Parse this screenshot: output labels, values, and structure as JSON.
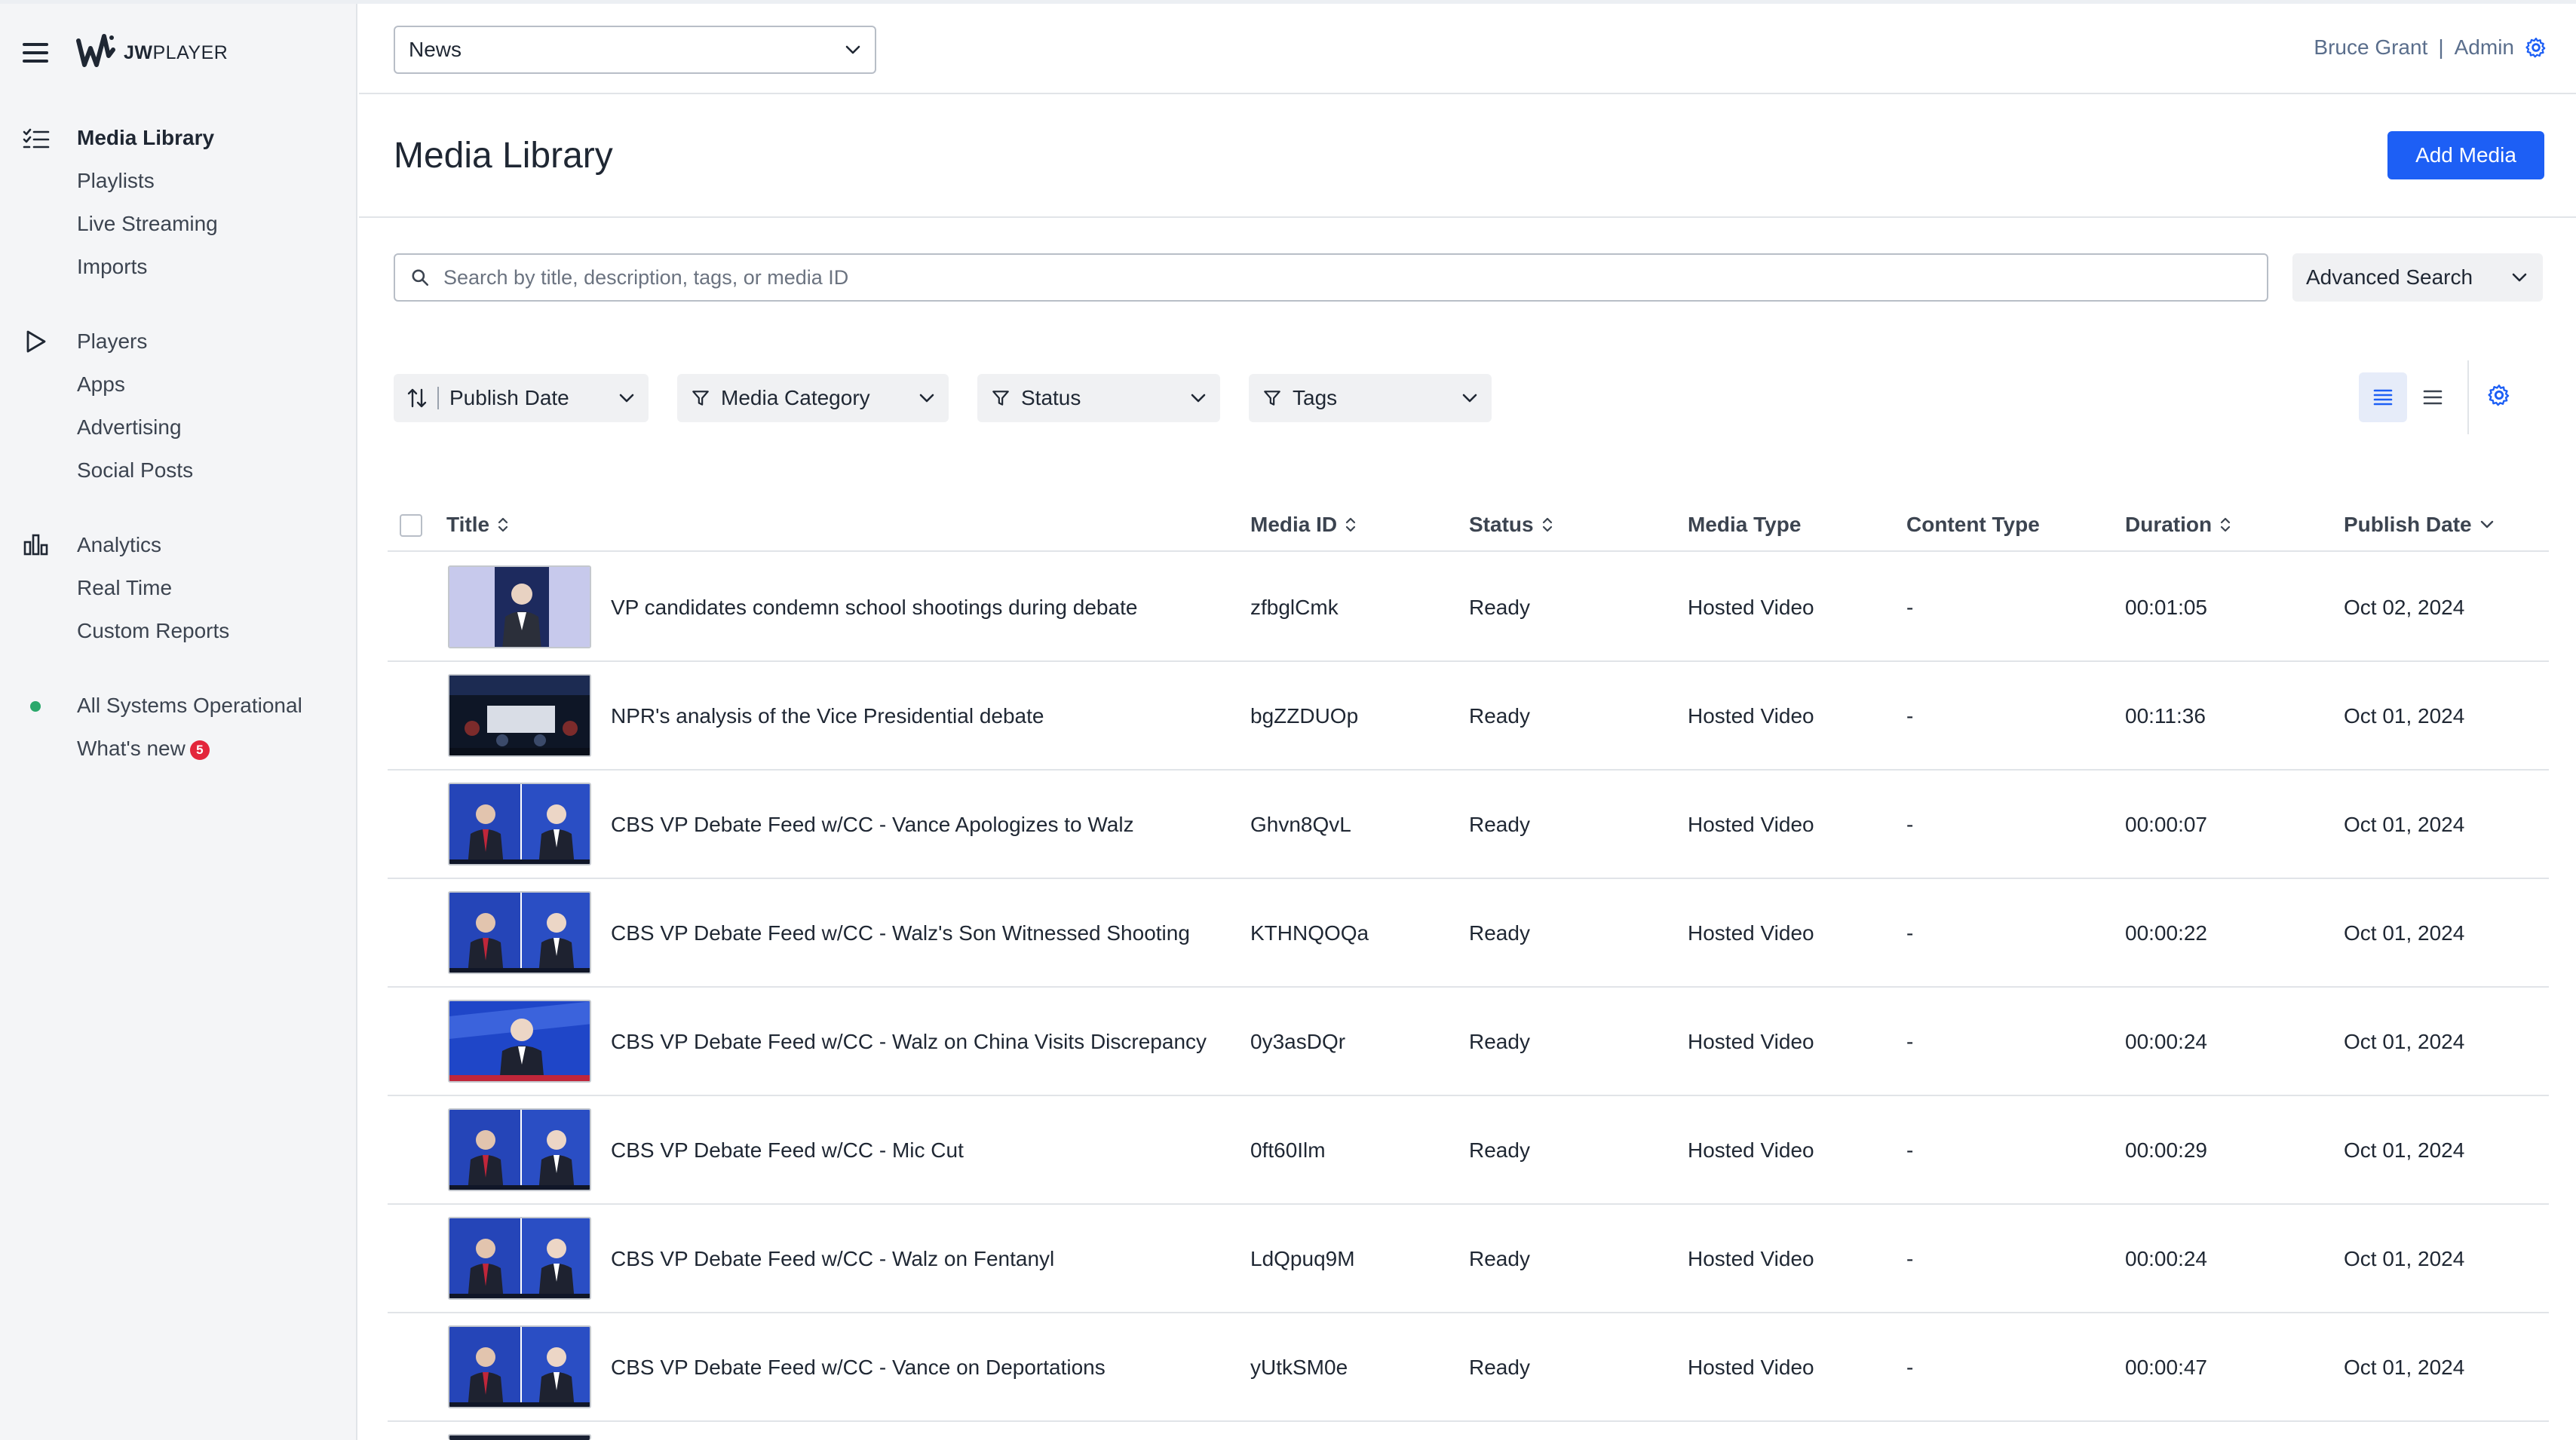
{
  "brand": {
    "name_bold": "JW",
    "name_light": "PLAYER"
  },
  "sidebar": {
    "group1": [
      "Media Library",
      "Playlists",
      "Live Streaming",
      "Imports"
    ],
    "group2": [
      "Players",
      "Apps",
      "Advertising",
      "Social Posts"
    ],
    "group3": [
      "Analytics",
      "Real Time",
      "Custom Reports"
    ],
    "status": "All Systems Operational",
    "whats_new": "What's new",
    "whats_new_count": "5"
  },
  "topbar": {
    "property_select": "News",
    "user_name": "Bruce Grant",
    "separator": "|",
    "role": "Admin"
  },
  "header": {
    "title": "Media Library",
    "add_button": "Add Media"
  },
  "search": {
    "placeholder": "Search by title, description, tags, or media ID",
    "advanced_label": "Advanced Search"
  },
  "filters": {
    "sort": "Publish Date",
    "category": "Media Category",
    "status": "Status",
    "tags": "Tags"
  },
  "table": {
    "columns": {
      "title": "Title",
      "media_id": "Media ID",
      "status": "Status",
      "media_type": "Media Type",
      "content_type": "Content Type",
      "duration": "Duration",
      "publish_date": "Publish Date"
    },
    "rows": [
      {
        "title": "VP candidates condemn school shootings during debate",
        "media_id": "zfbglCmk",
        "status": "Ready",
        "media_type": "Hosted Video",
        "content_type": "-",
        "duration": "00:01:05",
        "publish_date": "Oct 02, 2024"
      },
      {
        "title": "NPR's analysis of the Vice Presidential debate",
        "media_id": "bgZZDUOp",
        "status": "Ready",
        "media_type": "Hosted Video",
        "content_type": "-",
        "duration": "00:11:36",
        "publish_date": "Oct 01, 2024"
      },
      {
        "title": "CBS VP Debate Feed w/CC - Vance Apologizes to Walz",
        "media_id": "Ghvn8QvL",
        "status": "Ready",
        "media_type": "Hosted Video",
        "content_type": "-",
        "duration": "00:00:07",
        "publish_date": "Oct 01, 2024"
      },
      {
        "title": "CBS VP Debate Feed w/CC - Walz's Son Witnessed Shooting",
        "media_id": "KTHNQOQa",
        "status": "Ready",
        "media_type": "Hosted Video",
        "content_type": "-",
        "duration": "00:00:22",
        "publish_date": "Oct 01, 2024"
      },
      {
        "title": "CBS VP Debate Feed w/CC - Walz on China Visits Discrepancy",
        "media_id": "0y3asDQr",
        "status": "Ready",
        "media_type": "Hosted Video",
        "content_type": "-",
        "duration": "00:00:24",
        "publish_date": "Oct 01, 2024"
      },
      {
        "title": "CBS VP Debate Feed w/CC - Mic Cut",
        "media_id": "0ft60Ilm",
        "status": "Ready",
        "media_type": "Hosted Video",
        "content_type": "-",
        "duration": "00:00:29",
        "publish_date": "Oct 01, 2024"
      },
      {
        "title": "CBS VP Debate Feed w/CC - Walz on Fentanyl",
        "media_id": "LdQpuq9M",
        "status": "Ready",
        "media_type": "Hosted Video",
        "content_type": "-",
        "duration": "00:00:24",
        "publish_date": "Oct 01, 2024"
      },
      {
        "title": "CBS VP Debate Feed w/CC - Vance on Deportations",
        "media_id": "yUtkSM0e",
        "status": "Ready",
        "media_type": "Hosted Video",
        "content_type": "-",
        "duration": "00:00:47",
        "publish_date": "Oct 01, 2024"
      }
    ]
  },
  "colors": {
    "accent": "#1d5ff5",
    "sidebar_bg": "#f4f5f7",
    "status_ok": "#2aa86b",
    "badge": "#e3263b"
  },
  "icons": [
    "menu-icon",
    "media-library-icon",
    "players-icon",
    "analytics-icon",
    "gear-icon",
    "search-icon",
    "chevron-down-icon",
    "sort-icon",
    "filter-icon",
    "list-view-icon",
    "compact-view-icon"
  ]
}
